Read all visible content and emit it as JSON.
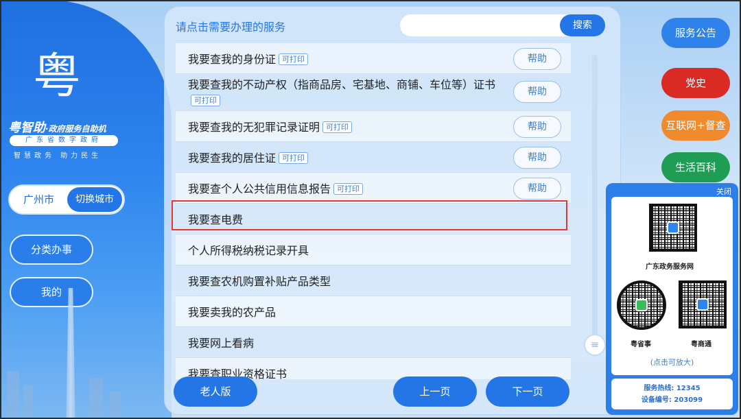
{
  "left": {
    "logo_glyph": "粤",
    "brand_name": "粤智助",
    "brand_sub": "·政府服务自助机",
    "ribbon": "广东省数字政府",
    "slogan": "智慧政务 助力民生",
    "city": "广州市",
    "switch_city": "切换城市",
    "category_btn": "分类办事",
    "mine_btn": "我的"
  },
  "main": {
    "title": "请点击需要办理的服务",
    "search_placeholder": "",
    "search_btn": "搜索",
    "rows": [
      {
        "text": "我要查我的身份证",
        "tag": "可打印",
        "help": "帮助"
      },
      {
        "text": "我要查我的不动产权（指商品房、宅基地、商铺、车位等）证书",
        "tag": "可打印",
        "help": "帮助"
      },
      {
        "text": "我要查我的无犯罪记录证明",
        "tag": "可打印",
        "help": "帮助"
      },
      {
        "text": "我要查我的居住证",
        "tag": "可打印",
        "help": "帮助"
      },
      {
        "text": "我要查个人公共信用信息报告",
        "tag": "可打印",
        "help": "帮助"
      },
      {
        "text": "我要查电费"
      },
      {
        "text": "个人所得税纳税记录开具"
      },
      {
        "text": "我要查农机购置补贴产品类型"
      },
      {
        "text": "我要卖我的农产品"
      },
      {
        "text": "我要网上看病"
      },
      {
        "text": "我要查职业资格证书"
      }
    ],
    "elder_btn": "老人版",
    "prev_btn": "上一页",
    "next_btn": "下一页"
  },
  "side": {
    "service_notice": "服务公告",
    "party_history": "党史",
    "internet_supervision": "互联网+督查",
    "life_encyclopedia": "生活百科"
  },
  "qr": {
    "close": "关闭",
    "gd_service_net": "广东政务服务网",
    "yue_sheng_shi": "粤省事",
    "yue_shang_tong": "粤商通",
    "click_enlarge": "(点击可放大)",
    "hotline": "服务热线: 12345",
    "device_no": "设备编号: 203099"
  },
  "colors": {
    "primary": "#2476e6",
    "party_red": "#d92a24",
    "orange": "#f08a2c",
    "green": "#1f9d55",
    "highlight": "#e8362d"
  }
}
